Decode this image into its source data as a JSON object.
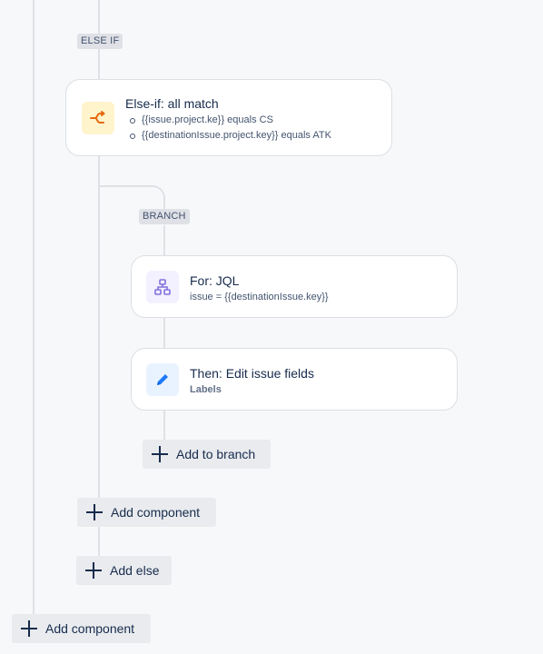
{
  "labels": {
    "else_if": "ELSE IF",
    "branch": "BRANCH"
  },
  "else_if_card": {
    "title": "Else-if: all match",
    "icon": "branch-condition-icon",
    "conditions": [
      "{{issue.project.ke}} equals CS",
      "{{destinationIssue.project.key}} equals ATK"
    ]
  },
  "for_card": {
    "title": "For: JQL",
    "icon": "hierarchy-icon",
    "subtitle": "issue = {{destinationIssue.key}}"
  },
  "then_card": {
    "title": "Then: Edit issue fields",
    "icon": "pencil-icon",
    "subtitle": "Labels"
  },
  "buttons": {
    "add_to_branch": "Add to branch",
    "add_component_inner": "Add component",
    "add_else": "Add else",
    "add_component_outer": "Add component"
  },
  "colors": {
    "background": "#f7f8f9",
    "connector": "#dfe1e6",
    "else_if_icon_bg": "#fff4cc",
    "else_if_icon": "#e56910",
    "for_icon_bg": "#f3f0ff",
    "for_icon": "#8270db",
    "then_icon_bg": "#e9f2ff",
    "then_icon": "#1d7afc"
  }
}
